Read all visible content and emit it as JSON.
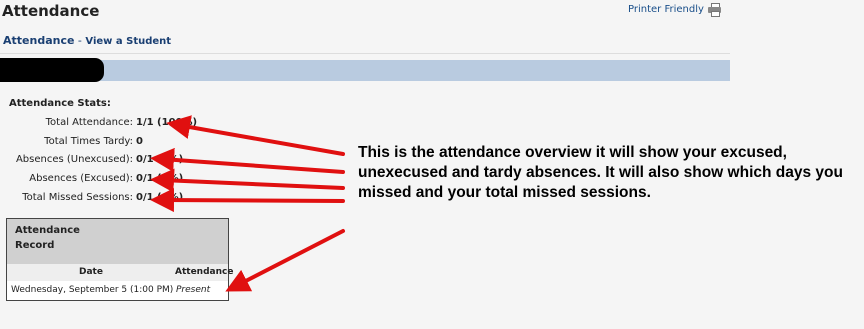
{
  "header": {
    "title": "Attendance",
    "printer_label": "Printer Friendly"
  },
  "subheader": {
    "main": "Attendance",
    "separator": " - ",
    "sub": "View a Student"
  },
  "stats": {
    "heading": "Attendance Stats:",
    "rows": [
      {
        "label": "Total Attendance:",
        "value": "1/1 (100%)"
      },
      {
        "label": "Total Times Tardy:",
        "value": "0"
      },
      {
        "label": "Absences (Unexcused):",
        "value": "0/1 (0%)"
      },
      {
        "label": "Absences (Excused):",
        "value": "0/1 (0%)"
      },
      {
        "label": "Total Missed Sessions:",
        "value": "0/1 (0%)"
      }
    ]
  },
  "record": {
    "title_line1": "Attendance",
    "title_line2": "Record",
    "col_date": "Date",
    "col_attendance": "Attendance",
    "rows": [
      {
        "date": "Wednesday, September 5 (1:00 PM)",
        "attendance": "Present"
      }
    ]
  },
  "annotation": {
    "text": "This is the attendance overview it will show your excused, unexecused and tardy absences. It will also show which days you missed and your total missed sessions."
  },
  "colors": {
    "student_bar": "#b9cbe0",
    "link": "#1a4f8a",
    "arrow": "#e01010",
    "redaction": "#000000"
  },
  "icons": [
    "printer-icon",
    "arrow-annotation"
  ]
}
